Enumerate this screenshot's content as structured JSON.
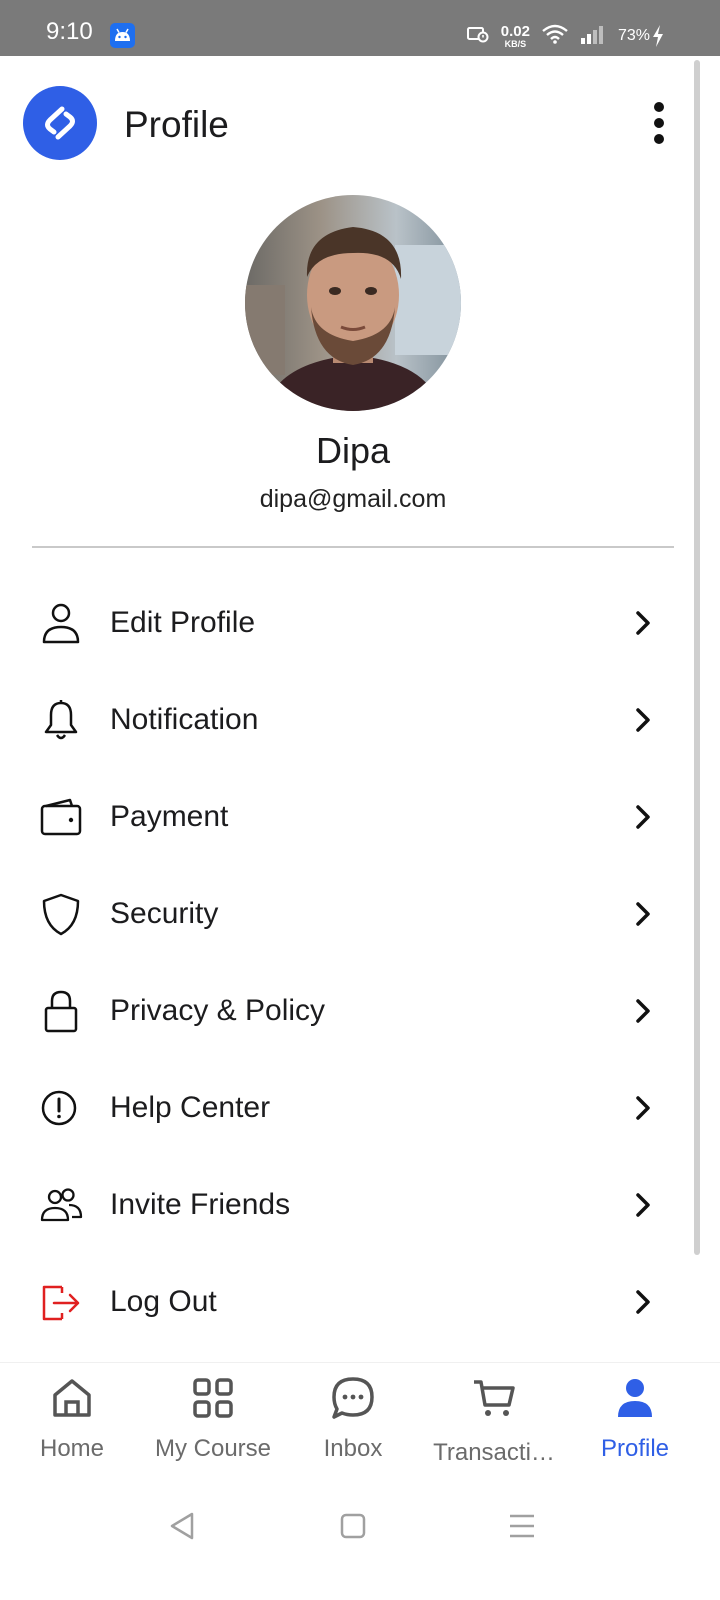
{
  "status_bar": {
    "time": "9:10",
    "speed_value": "0.02",
    "speed_unit": "KB/S",
    "battery": "73%"
  },
  "header": {
    "title": "Profile"
  },
  "profile": {
    "name": "Dipa",
    "email": "dipa@gmail.com"
  },
  "menu": {
    "items": [
      {
        "label": "Edit Profile",
        "icon": "person-icon"
      },
      {
        "label": "Notification",
        "icon": "bell-icon"
      },
      {
        "label": "Payment",
        "icon": "wallet-icon"
      },
      {
        "label": "Security",
        "icon": "shield-icon"
      },
      {
        "label": "Privacy & Policy",
        "icon": "lock-icon"
      },
      {
        "label": "Help Center",
        "icon": "info-circle-icon"
      },
      {
        "label": "Invite Friends",
        "icon": "people-icon"
      },
      {
        "label": "Log Out",
        "icon": "logout-icon"
      }
    ]
  },
  "bottom_nav": {
    "items": [
      {
        "label": "Home",
        "icon": "home-icon"
      },
      {
        "label": "My Course",
        "icon": "grid-icon"
      },
      {
        "label": "Inbox",
        "icon": "chat-icon"
      },
      {
        "label": "Transacti…",
        "icon": "cart-icon"
      },
      {
        "label": "Profile",
        "icon": "person-icon"
      }
    ],
    "active": "Profile"
  },
  "colors": {
    "accent": "#2f5fe6",
    "logout": "#e02020",
    "status_bar": "#7a7a7a"
  }
}
